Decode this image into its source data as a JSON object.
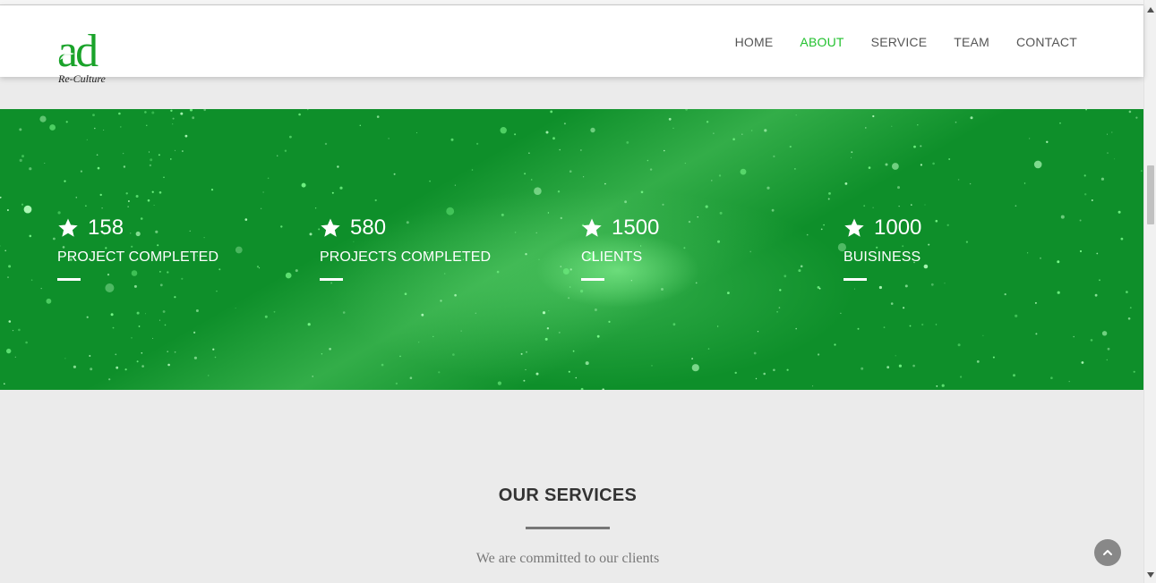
{
  "brand": {
    "logo_text": "ad",
    "tagline": "Re-Culture",
    "accent_color": "#22c12e",
    "logo_color": "#1aa32a"
  },
  "nav": {
    "items": [
      {
        "label": "HOME",
        "active": false
      },
      {
        "label": "ABOUT",
        "active": true
      },
      {
        "label": "SERVICE",
        "active": false
      },
      {
        "label": "TEAM",
        "active": false
      },
      {
        "label": "CONTACT",
        "active": false
      }
    ]
  },
  "stats": [
    {
      "icon": "star-icon",
      "value": "158",
      "label": "PROJECT COMPLETED"
    },
    {
      "icon": "star-icon",
      "value": "580",
      "label": "PROJECTS COMPLETED"
    },
    {
      "icon": "star-icon",
      "value": "1500",
      "label": "CLIENTS"
    },
    {
      "icon": "star-icon",
      "value": "1000",
      "label": "BUISINESS"
    }
  ],
  "hero": {
    "background_color": "#0e8f2a"
  },
  "services": {
    "title": "OUR SERVICES",
    "subtitle": "We are committed to our clients"
  },
  "scroll_top": {
    "icon": "chevron-up-icon"
  }
}
